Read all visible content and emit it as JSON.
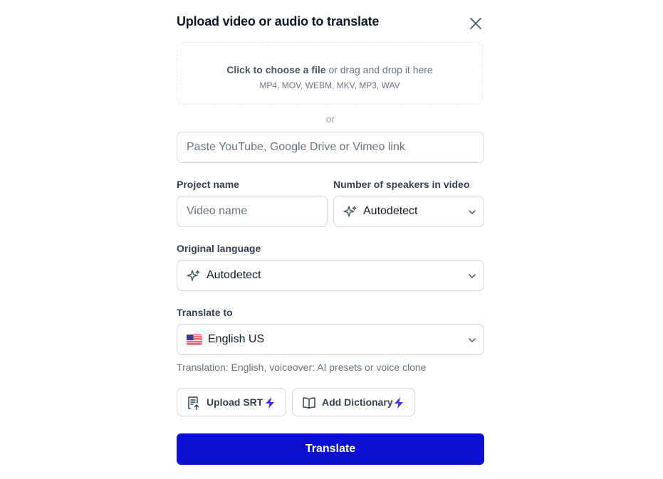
{
  "dialog": {
    "title": "Upload video or audio to translate",
    "close_icon": "close-icon"
  },
  "dropzone": {
    "choose_text": "Click to choose a file",
    "drag_text": " or drag and drop it here",
    "formats": "MP4, MOV, WEBM, MKV, MP3, WAV"
  },
  "or_label": "or",
  "link_input": {
    "placeholder": "Paste YouTube, Google Drive or Vimeo link",
    "value": ""
  },
  "project_name": {
    "label": "Project name",
    "placeholder": "Video name",
    "value": ""
  },
  "speakers": {
    "label": "Number of speakers in video",
    "value": "Autodetect",
    "icon": "sparkles-icon"
  },
  "original_language": {
    "label": "Original language",
    "value": "Autodetect",
    "icon": "sparkles-icon"
  },
  "translate_to": {
    "label": "Translate to",
    "value": "English US",
    "icon": "us-flag-icon"
  },
  "hint": "Translation: English, voiceover: AI presets or voice clone",
  "buttons": {
    "upload_srt": "Upload SRT",
    "add_dictionary": "Add Dictionary",
    "translate": "Translate"
  },
  "colors": {
    "primary": "#0b0fcf",
    "accent_bolt": "#3b36e6",
    "border": "#d1d5db"
  }
}
